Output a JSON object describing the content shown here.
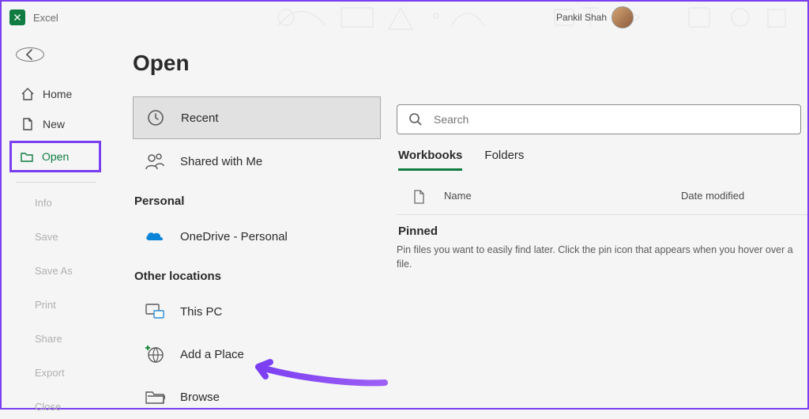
{
  "app": {
    "name": "Excel",
    "user_name": "Pankil Shah"
  },
  "sidebar": {
    "items": [
      {
        "label": "Home"
      },
      {
        "label": "New"
      },
      {
        "label": "Open"
      }
    ],
    "secondary": [
      {
        "label": "Info"
      },
      {
        "label": "Save"
      },
      {
        "label": "Save As"
      },
      {
        "label": "Print"
      },
      {
        "label": "Share"
      },
      {
        "label": "Export"
      },
      {
        "label": "Close"
      }
    ]
  },
  "page": {
    "title": "Open"
  },
  "locations": {
    "recent": "Recent",
    "shared": "Shared with Me",
    "personal_header": "Personal",
    "onedrive": "OneDrive - Personal",
    "other_header": "Other locations",
    "thispc": "This PC",
    "addplace": "Add a Place",
    "browse": "Browse"
  },
  "files": {
    "search_placeholder": "Search",
    "tabs": {
      "workbooks": "Workbooks",
      "folders": "Folders"
    },
    "columns": {
      "name": "Name",
      "date": "Date modified"
    },
    "pinned_header": "Pinned",
    "pinned_empty": "Pin files you want to easily find later. Click the pin icon that appears when you hover over a file."
  }
}
